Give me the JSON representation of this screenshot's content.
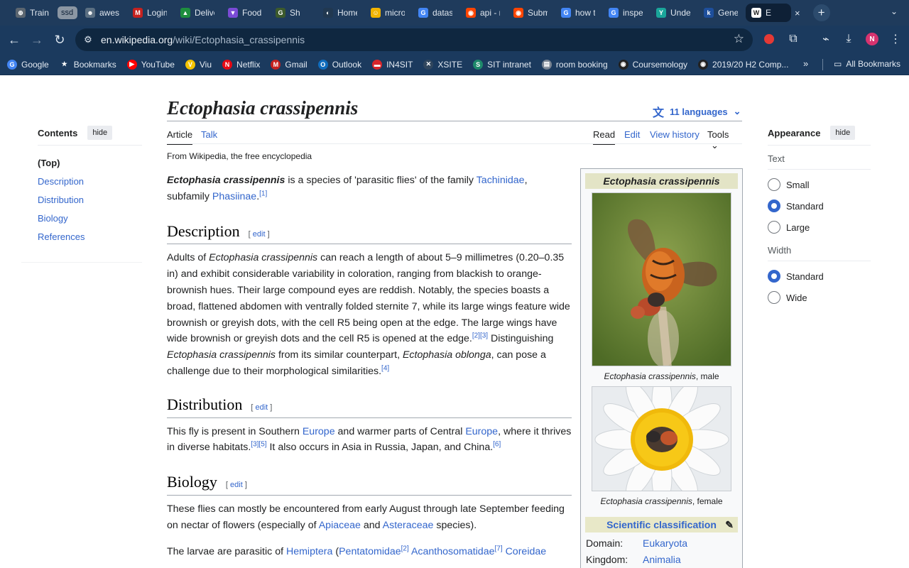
{
  "browser": {
    "tabs": [
      {
        "title": "Train",
        "color": "#5c6670",
        "glyph": "⊕"
      },
      {
        "title": "ssd",
        "color": "#7a8593",
        "glyph": "",
        "group": true
      },
      {
        "title": "awes",
        "color": "#5b6f82",
        "glyph": "☻"
      },
      {
        "title": "Login",
        "color": "#c5221f",
        "glyph": "M"
      },
      {
        "title": "Delive",
        "color": "#1e8e3e",
        "glyph": "▲"
      },
      {
        "title": "Food",
        "color": "#7b4bd6",
        "glyph": "▼"
      },
      {
        "title": "Sh",
        "color": "#3c5a2c",
        "glyph": "G"
      },
      {
        "title": "Home",
        "color": "#213850",
        "glyph": "◐"
      },
      {
        "title": "micro",
        "color": "#f2b400",
        "glyph": "☺"
      },
      {
        "title": "datas",
        "color": "#4285f4",
        "glyph": "G"
      },
      {
        "title": "api - r",
        "color": "#ff4500",
        "glyph": "◉"
      },
      {
        "title": "Subm",
        "color": "#ff4500",
        "glyph": "◉"
      },
      {
        "title": "how t",
        "color": "#4285f4",
        "glyph": "G"
      },
      {
        "title": "inspe",
        "color": "#4285f4",
        "glyph": "G"
      },
      {
        "title": "Unde",
        "color": "#1aa59a",
        "glyph": "Y"
      },
      {
        "title": "Gene",
        "color": "#1e4f9c",
        "glyph": "k"
      },
      {
        "title": "E",
        "color": "#ffffff",
        "glyph": "W",
        "active": true
      }
    ],
    "close_glyph": "×",
    "new_tab_glyph": "+",
    "url_host": "en.wikipedia.org",
    "url_path": "/wiki/Ectophasia_crassipennis",
    "profile_initial": "N",
    "bookmarks": [
      {
        "label": "Google",
        "color": "#4285f4",
        "glyph": "G"
      },
      {
        "label": "Bookmarks",
        "color": "#1b3a5e",
        "glyph": "★"
      },
      {
        "label": "YouTube",
        "color": "#ff0000",
        "glyph": "▶"
      },
      {
        "label": "Viu",
        "color": "#f5c400",
        "glyph": "V"
      },
      {
        "label": "Netflix",
        "color": "#e50914",
        "glyph": "N"
      },
      {
        "label": "Gmail",
        "color": "#c5221f",
        "glyph": "M"
      },
      {
        "label": "Outlook",
        "color": "#0f6cbd",
        "glyph": "O"
      },
      {
        "label": "IN4SIT",
        "color": "#d7262b",
        "glyph": "▬"
      },
      {
        "label": "XSITE",
        "color": "#31475e",
        "glyph": "✕"
      },
      {
        "label": "SIT intranet",
        "color": "#1e8a6b",
        "glyph": "S"
      },
      {
        "label": "room booking",
        "color": "#7a8593",
        "glyph": "▤"
      },
      {
        "label": "Coursemology",
        "color": "#222222",
        "glyph": "◉"
      },
      {
        "label": "2019/20 H2 Comp...",
        "color": "#222222",
        "glyph": "◉"
      }
    ],
    "more_bookmarks": "»",
    "all_bookmarks": "All Bookmarks"
  },
  "article": {
    "title": "Ectophasia crassipennis",
    "languages": "11 languages",
    "tab_article": "Article",
    "tab_talk": "Talk",
    "tab_read": "Read",
    "tab_edit": "Edit",
    "tab_history": "View history",
    "tab_tools": "Tools",
    "tagline": "From Wikipedia, the free encyclopedia",
    "intro_bold": "Ectophasia crassipennis",
    "intro_1": " is a species of 'parasitic flies' of the family ",
    "intro_link_tachinidae": "Tachinidae",
    "intro_2": ", subfamily ",
    "intro_link_phasiinae": "Phasiinae",
    "intro_3": ".",
    "ref_1": "[1]",
    "edit_word": "edit",
    "desc_heading": "Description",
    "desc_1": "Adults of ",
    "desc_italic_1": "Ectophasia crassipennis",
    "desc_2": " can reach a length of about 5–9 millimetres (0.20–0.35 in) and exhibit considerable variability in coloration, ranging from blackish to orange-brownish hues. Their large compound eyes are reddish. Notably, the species boasts a broad, flattened abdomen with ventrally folded sternite 7, while its large wings feature wide brownish or greyish dots, with the cell R5 being open at the edge. The large wings have wide brownish or greyish dots and the cell R5 is opened at the edge.",
    "ref_2_3": "[2][3]",
    "desc_3": " Distinguishing ",
    "desc_italic_2": "Ectophasia crassipennis",
    "desc_4": " from its similar counterpart, ",
    "desc_italic_3": "Ectophasia oblonga",
    "desc_5": ", can pose a challenge due to their morphological similarities.",
    "ref_4": "[4]",
    "dist_heading": "Distribution",
    "dist_1": "This fly is present in Southern ",
    "dist_link_europe": "Europe",
    "dist_2": " and warmer parts of Central ",
    "dist_3": ", where it thrives in diverse habitats.",
    "ref_3_5": "[3][5]",
    "dist_4": " It also occurs in Asia in Russia, Japan, and China.",
    "ref_6": "[6]",
    "bio_heading": "Biology",
    "bio_1": "These flies can mostly be encountered from early August through late September feeding on nectar of flowers (especially of ",
    "bio_link_apiaceae": "Apiaceae",
    "bio_2": " and ",
    "bio_link_asteraceae": "Asteraceae",
    "bio_3": " species).",
    "bio_4": "The larvae are parasitic of ",
    "bio_link_hemiptera": "Hemiptera",
    "bio_5": " (",
    "bio_link_pentatomidae": "Pentatomidae",
    "ref_2": "[2]",
    "bio_6": " ",
    "bio_link_acanthosomatidae": "Acanthosomatidae",
    "ref_7": "[7]",
    "bio_link_coreidae": "Coreidae"
  },
  "toc": {
    "heading": "Contents",
    "hide": "hide",
    "items": [
      "(Top)",
      "Description",
      "Distribution",
      "Biology",
      "References"
    ]
  },
  "infobox": {
    "title": "Ectophasia crassipennis",
    "caption1_italic": "Ectophasia crassipennis",
    "caption1_rest": ", male",
    "caption2_italic": "Ectophasia crassipennis",
    "caption2_rest": ", female",
    "classification": "Scientific classification",
    "rows": [
      {
        "key": "Domain:",
        "value": "Eukaryota"
      },
      {
        "key": "Kingdom:",
        "value": "Animalia"
      }
    ]
  },
  "appearance": {
    "heading": "Appearance",
    "hide": "hide",
    "text_label": "Text",
    "text_options": [
      {
        "label": "Small",
        "selected": false
      },
      {
        "label": "Standard",
        "selected": true
      },
      {
        "label": "Large",
        "selected": false
      }
    ],
    "width_label": "Width",
    "width_options": [
      {
        "label": "Standard",
        "selected": true
      },
      {
        "label": "Wide",
        "selected": false
      }
    ]
  }
}
